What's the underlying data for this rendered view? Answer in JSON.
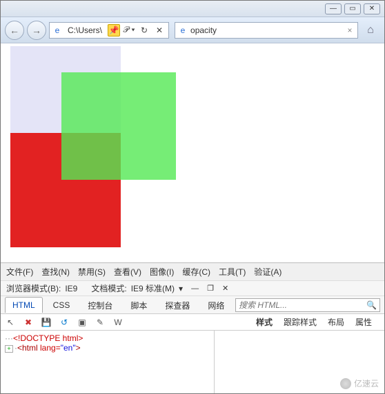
{
  "titlebar": {
    "min": "—",
    "max": "▭",
    "close": "✕"
  },
  "nav": {
    "back": "←",
    "forward": "→",
    "addr_text": "C:\\Users\\",
    "pin": "📌",
    "search_dd": "𝒫 ▾",
    "refresh": "↻",
    "stop": "✕",
    "tab_title": "opacity",
    "tab_close": "×",
    "home": "⌂"
  },
  "menu": {
    "file": "文件(F)",
    "find": "查找(N)",
    "disable": "禁用(S)",
    "view": "查看(V)",
    "image": "图像(I)",
    "cache": "缓存(C)",
    "tools": "工具(T)",
    "validate": "验证(A)"
  },
  "mode": {
    "browser_label": "浏览器模式(B):",
    "browser_val": "IE9",
    "doc_label": "文档模式:",
    "doc_val": "IE9 标准(M)",
    "dd": "▾",
    "min": "—",
    "pop": "❐",
    "close": "✕"
  },
  "devtabs": {
    "html": "HTML",
    "css": "CSS",
    "console": "控制台",
    "script": "脚本",
    "profiler": "探查器",
    "network": "网络",
    "search_ph": "搜索 HTML...",
    "mag": "🔍"
  },
  "toolbar": {
    "cursor": "↖",
    "x": "✖",
    "save": "💾",
    "sync": "↺",
    "box": "▣",
    "edit": "✎",
    "word": "W"
  },
  "righttabs": {
    "style": "样式",
    "trace": "跟踪样式",
    "layout": "布局",
    "attrs": "属性"
  },
  "source": {
    "doctype": "<!DOCTYPE html>",
    "html_open": "<html ",
    "lang_attr": "lang=",
    "lang_val": "\"en\"",
    "html_close": ">",
    "toggle": "+"
  },
  "watermark": "亿速云"
}
